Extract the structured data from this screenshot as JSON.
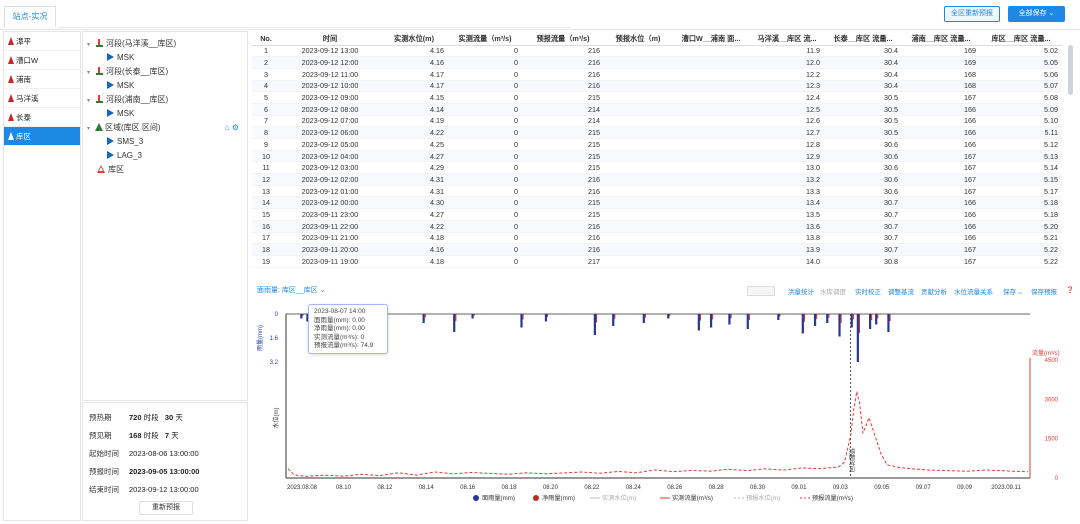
{
  "tab": "站点-实况",
  "top_buttons": {
    "refresh_all": "全区重新预报",
    "save_all": "全部保存",
    "save_all_icon": "chevron-down-icon"
  },
  "left_nav": [
    {
      "label": "漳平",
      "active": false
    },
    {
      "label": "漕口W",
      "active": false
    },
    {
      "label": "浦南",
      "active": false
    },
    {
      "label": "马洋溪",
      "active": false
    },
    {
      "label": "长泰",
      "active": false
    },
    {
      "label": "库区",
      "active": true
    }
  ],
  "tree": {
    "n1": "河段(马洋溪__库区)",
    "n1c": "MSK",
    "n2": "河段(长泰__库区)",
    "n2c": "MSK",
    "n3": "河段(浦南__库区)",
    "n3c": "MSK",
    "n4": "区域(库区 区间)",
    "n4c1": "SMS_3",
    "n4c2": "LAG_3",
    "n5": "库区"
  },
  "params": {
    "warmup_label": "预热期",
    "warmup_hours": "720",
    "warmup_hours_unit": "时段",
    "warmup_days": "30",
    "warmup_days_unit": "天",
    "forecast_label": "预见期",
    "forecast_hours": "168",
    "forecast_hours_unit": "时段",
    "forecast_days": "7",
    "forecast_days_unit": "天",
    "start_label": "起始时间",
    "start_value": "2023-08-06 13:00:00",
    "fc_label": "预报时间",
    "fc_value": "2023-09-05 13:00:00",
    "end_label": "结束时间",
    "end_value": "2023-09-12 13:00:00",
    "reset_btn": "重新预报"
  },
  "table": {
    "headers": [
      "No.",
      "时间",
      "实测水位(m)",
      "实测流量（m³/s)",
      "预报流量（m³/s)",
      "预报水位（m)",
      "漕口W__浦南 面...",
      "马洋溪__库区 流...",
      "长泰__库区 流量...",
      "浦南__库区 流量...",
      "库区__库区 流量..."
    ],
    "rows": [
      [
        "1",
        "2023-09-12 13:00",
        "4.16",
        "0",
        "216",
        "",
        "",
        "11.9",
        "30.4",
        "169",
        "5.02"
      ],
      [
        "2",
        "2023-09-12 12:00",
        "4.16",
        "0",
        "216",
        "",
        "",
        "12.0",
        "30.4",
        "169",
        "5.05"
      ],
      [
        "3",
        "2023-09-12 11:00",
        "4.17",
        "0",
        "216",
        "",
        "",
        "12.2",
        "30.4",
        "168",
        "5.06"
      ],
      [
        "4",
        "2023-09-12 10:00",
        "4.17",
        "0",
        "216",
        "",
        "",
        "12.3",
        "30.4",
        "168",
        "5.07"
      ],
      [
        "5",
        "2023-09-12 09:00",
        "4.15",
        "0",
        "215",
        "",
        "",
        "12.4",
        "30.5",
        "167",
        "5.08"
      ],
      [
        "6",
        "2023-09-12 08:00",
        "4.14",
        "0",
        "214",
        "",
        "",
        "12.5",
        "30.5",
        "166",
        "5.09"
      ],
      [
        "7",
        "2023-09-12 07:00",
        "4.19",
        "0",
        "214",
        "",
        "",
        "12.6",
        "30.5",
        "166",
        "5.10"
      ],
      [
        "8",
        "2023-09-12 06:00",
        "4.22",
        "0",
        "215",
        "",
        "",
        "12.7",
        "30.5",
        "166",
        "5.11"
      ],
      [
        "9",
        "2023-09-12 05:00",
        "4.25",
        "0",
        "215",
        "",
        "",
        "12.8",
        "30.6",
        "166",
        "5.12"
      ],
      [
        "10",
        "2023-09-12 04:00",
        "4.27",
        "0",
        "215",
        "",
        "",
        "12.9",
        "30.6",
        "167",
        "5.13"
      ],
      [
        "11",
        "2023-09-12 03:00",
        "4.29",
        "0",
        "215",
        "",
        "",
        "13.0",
        "30.6",
        "167",
        "5.14"
      ],
      [
        "12",
        "2023-09-12 02:00",
        "4.31",
        "0",
        "216",
        "",
        "",
        "13.2",
        "30.6",
        "167",
        "5.15"
      ],
      [
        "13",
        "2023-09-12 01:00",
        "4.31",
        "0",
        "216",
        "",
        "",
        "13.3",
        "30.6",
        "167",
        "5.17"
      ],
      [
        "14",
        "2023-09-12 00:00",
        "4.30",
        "0",
        "215",
        "",
        "",
        "13.4",
        "30.7",
        "166",
        "5.18"
      ],
      [
        "15",
        "2023-09-11 23:00",
        "4.27",
        "0",
        "215",
        "",
        "",
        "13.5",
        "30.7",
        "166",
        "5.18"
      ],
      [
        "16",
        "2023-09-11 22:00",
        "4.22",
        "0",
        "216",
        "",
        "",
        "13.6",
        "30.7",
        "166",
        "5.20"
      ],
      [
        "17",
        "2023-09-11 21:00",
        "4.18",
        "0",
        "216",
        "",
        "",
        "13.8",
        "30.7",
        "166",
        "5.21"
      ],
      [
        "18",
        "2023-09-11 20:00",
        "4.16",
        "0",
        "216",
        "",
        "",
        "13.9",
        "30.7",
        "167",
        "5.22"
      ],
      [
        "19",
        "2023-09-11 19:00",
        "4.18",
        "0",
        "217",
        "",
        "",
        "14.0",
        "30.8",
        "167",
        "5.22"
      ]
    ]
  },
  "chart_toolbar": {
    "rain_selector": "面雨量: 库区__库区",
    "tools": [
      "洪量统计",
      "水库调度",
      "实时校正",
      "调整基流",
      "贡献分析",
      "水位流量关系",
      "保存",
      "保存预报"
    ],
    "help_icon": "help-icon"
  },
  "tooltip": [
    "2023-08-07 14:00",
    "面雨量(mm): 0.00",
    "净雨量(mm): 0.00",
    "实测流量(m³/s): 0",
    "预报流量(m³/s): 74.9"
  ],
  "colors": {
    "accent": "#1e88e5",
    "rain": "#283593",
    "net_rain": "#c62828",
    "flow": "#e53935"
  },
  "chart_data": {
    "type": "line",
    "x": [
      "2023.08.08",
      "08.10",
      "08.12",
      "08.14",
      "08.16",
      "08.18",
      "08.20",
      "08.22",
      "08.24",
      "08.26",
      "08.28",
      "08.30",
      "09.01",
      "09.03",
      "09.05",
      "09.07",
      "09.09",
      "2023.09.11"
    ],
    "rain_axis": {
      "label": "雨量(mm)",
      "ticks": [
        "0",
        "1.6",
        "3.2"
      ]
    },
    "flow_axis": {
      "label": "流量(m³/s)",
      "ticks": [
        "4500",
        "3000",
        "1500",
        "0"
      ],
      "ylim": [
        0,
        4500
      ]
    },
    "level_axis_label": "水位(m)",
    "forecast_marker_label": "预报时间",
    "legend": [
      "面雨量(mm)",
      "净雨量(mm)",
      "实测水位(m)",
      "实测流量(m³/s)",
      "预报水位(m)",
      "预报流量(m³/s)"
    ],
    "rain_bars": [
      [
        2,
        0.3
      ],
      [
        3,
        0.5
      ],
      [
        5,
        0.2
      ],
      [
        8,
        0.8
      ],
      [
        10,
        1.0
      ],
      [
        14,
        0.4
      ],
      [
        22,
        0.6
      ],
      [
        27,
        1.2
      ],
      [
        30,
        0.3
      ],
      [
        38,
        0.9
      ],
      [
        42,
        0.5
      ],
      [
        50,
        1.4
      ],
      [
        53,
        0.8
      ],
      [
        58,
        0.6
      ],
      [
        62,
        0.3
      ],
      [
        67,
        1.1
      ],
      [
        69,
        0.9
      ],
      [
        72,
        0.7
      ],
      [
        75,
        1.0
      ],
      [
        80,
        0.4
      ],
      [
        84,
        1.3
      ],
      [
        86,
        0.8
      ],
      [
        88,
        0.6
      ],
      [
        90,
        1.5
      ],
      [
        92,
        0.9
      ],
      [
        93,
        3.2
      ],
      [
        95,
        1.0
      ],
      [
        96,
        0.7
      ],
      [
        98,
        1.2
      ]
    ],
    "forecast_flow": [
      [
        0,
        350
      ],
      [
        1,
        120
      ],
      [
        3,
        60
      ],
      [
        6,
        110
      ],
      [
        9,
        70
      ],
      [
        12,
        140
      ],
      [
        15,
        90
      ],
      [
        18,
        200
      ],
      [
        21,
        110
      ],
      [
        24,
        230
      ],
      [
        27,
        160
      ],
      [
        30,
        210
      ],
      [
        33,
        180
      ],
      [
        36,
        140
      ],
      [
        39,
        200
      ],
      [
        42,
        160
      ],
      [
        45,
        190
      ],
      [
        48,
        230
      ],
      [
        51,
        180
      ],
      [
        54,
        250
      ],
      [
        57,
        200
      ],
      [
        60,
        310
      ],
      [
        63,
        240
      ],
      [
        66,
        290
      ],
      [
        69,
        260
      ],
      [
        72,
        330
      ],
      [
        75,
        280
      ],
      [
        78,
        350
      ],
      [
        81,
        300
      ],
      [
        84,
        380
      ],
      [
        87,
        360
      ],
      [
        90,
        420
      ],
      [
        91,
        600
      ],
      [
        92,
        1600
      ],
      [
        92.5,
        2600
      ],
      [
        93,
        3300
      ],
      [
        93.5,
        2800
      ],
      [
        94,
        1700
      ],
      [
        95,
        2300
      ],
      [
        96,
        1600
      ],
      [
        97,
        900
      ],
      [
        98,
        500
      ],
      [
        100,
        400
      ],
      [
        102,
        350
      ],
      [
        105,
        300
      ],
      [
        108,
        280
      ],
      [
        111,
        260
      ],
      [
        114,
        300
      ],
      [
        117,
        280
      ],
      [
        119,
        250
      ],
      [
        121,
        240
      ]
    ]
  }
}
